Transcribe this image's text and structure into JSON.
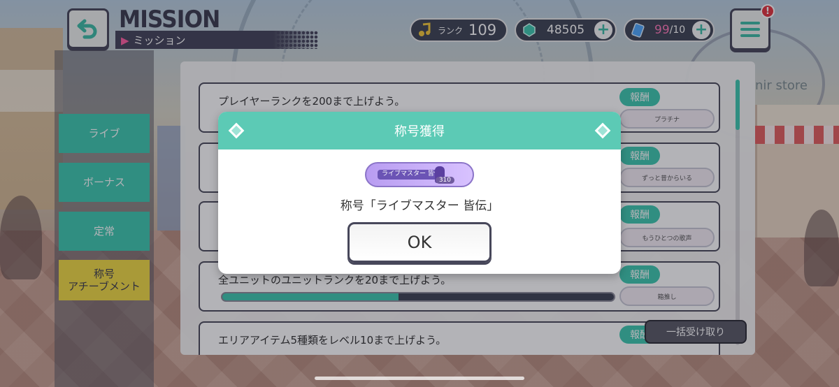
{
  "header": {
    "title_en": "MISSION",
    "title_jp": "ミッション",
    "rank_label": "ランク",
    "rank_value": "109",
    "gems": "48505",
    "ap_current": "99",
    "ap_max": "/10",
    "alert": "!"
  },
  "sidebar": {
    "tabs": [
      {
        "label": "ライブ"
      },
      {
        "label": "ボーナス"
      },
      {
        "label": "定常"
      },
      {
        "label": "称号\nアチーブメント",
        "active": true
      }
    ]
  },
  "missions": [
    {
      "text": "プレイヤーランクを200まで上げよう。",
      "reward_label": "報酬",
      "reward": "プラチナ"
    },
    {
      "text": "",
      "reward_label": "報酬",
      "reward": "ずっと昔からいる"
    },
    {
      "text": "",
      "reward_label": "報酬",
      "reward": "もうひとつの歌声"
    },
    {
      "text": "全ユニットのユニットランクを20まで上げよう。",
      "reward_label": "報酬",
      "reward": "箱推し",
      "progress": 0.45
    },
    {
      "text": "エリアアイテム5種類をレベル10まで上げよう。",
      "reward_label": "報酬",
      "reward": ""
    }
  ],
  "claim_all": "一括受け取り",
  "background": {
    "store_sign": "nir store"
  },
  "modal": {
    "title": "称号獲得",
    "badge_text": "ライブマスター 皆伝",
    "badge_number": "310",
    "message": "称号「ライブマスター 皆伝」",
    "ok": "OK"
  },
  "colors": {
    "accent": "#3ec9b0",
    "header": "#5ccab5",
    "active_tab": "#f1da45",
    "dark": "#47475a"
  }
}
